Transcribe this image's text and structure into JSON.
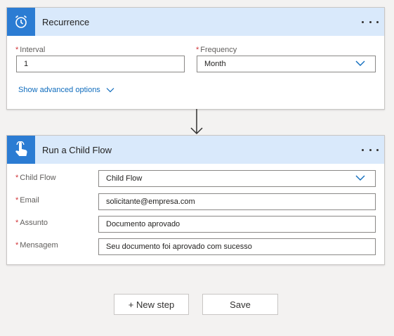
{
  "recurrence": {
    "title": "Recurrence",
    "interval": {
      "label": "Interval",
      "value": "1"
    },
    "frequency": {
      "label": "Frequency",
      "value": "Month"
    },
    "advanced_link": "Show advanced options"
  },
  "child_flow_step": {
    "title": "Run a Child Flow",
    "child_flow": {
      "label": "Child Flow",
      "value": "Child Flow"
    },
    "email": {
      "label": "Email",
      "value": "solicitante@empresa.com"
    },
    "assunto": {
      "label": "Assunto",
      "value": "Documento aprovado"
    },
    "mensagem": {
      "label": "Mensagem",
      "value": "Seu documento foi aprovado com sucesso"
    }
  },
  "footer": {
    "new_step_label": "+ New step",
    "save_label": "Save"
  },
  "icons": {
    "recurrence": "alarm-clock-icon",
    "child_flow": "touch-hand-icon",
    "more": "more-options-icon",
    "chevron": "chevron-down-icon",
    "arrow": "arrow-down-icon"
  },
  "colors": {
    "header_bg": "#d9e9fb",
    "icon_bg": "#2b7cd3",
    "link": "#0f6cbd",
    "required": "#d13438"
  }
}
